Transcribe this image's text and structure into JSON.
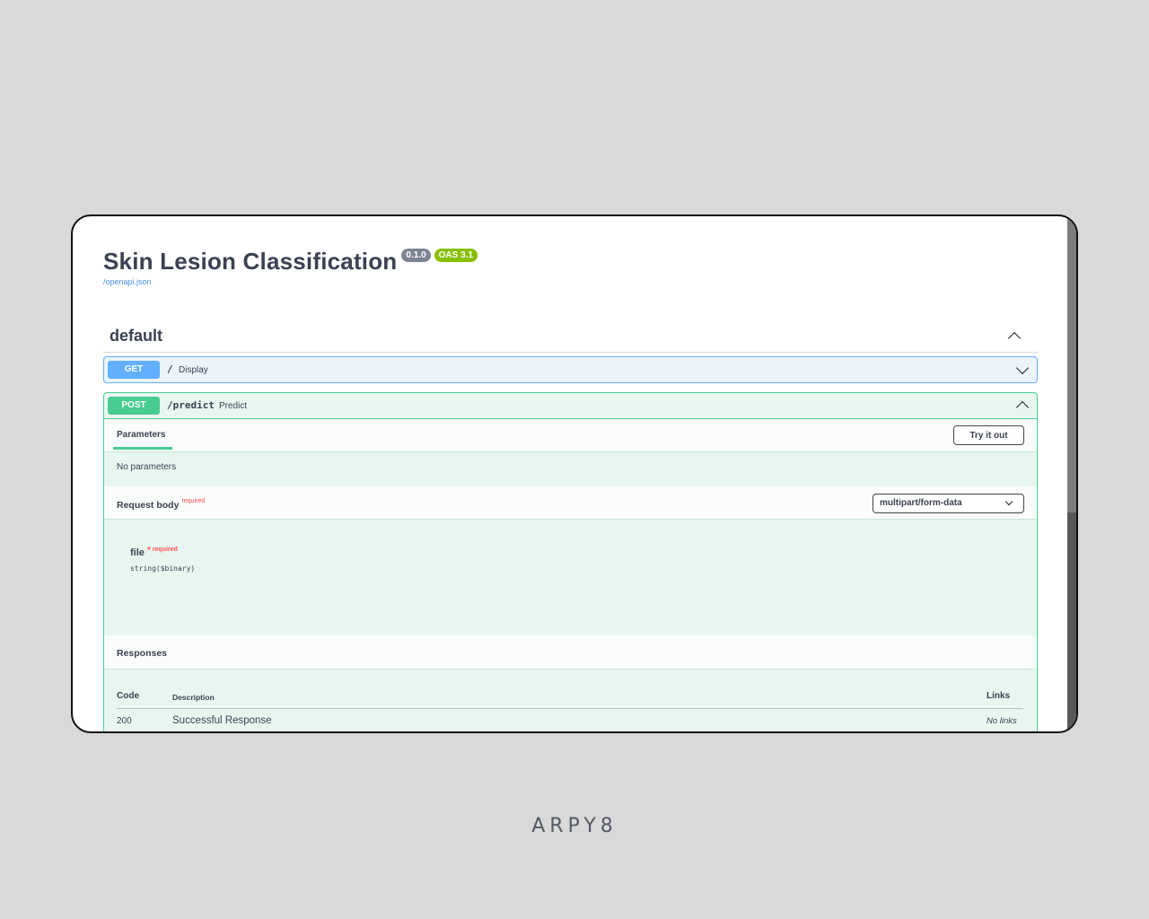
{
  "app": {
    "title": "Skin Lesion Classification",
    "version_badge": "0.1.0",
    "oas_badge": "OAS 3.1",
    "spec_link": "/openapi.json"
  },
  "tag": {
    "name": "default",
    "expanded": true
  },
  "operations": [
    {
      "method": "GET",
      "path": "/",
      "summary": "Display",
      "expanded": false
    },
    {
      "method": "POST",
      "path": "/predict",
      "summary": "Predict",
      "expanded": true,
      "parameters_tab": "Parameters",
      "try_button": "Try it out",
      "no_params_text": "No parameters",
      "request_body": {
        "label": "Request body",
        "required_text": "required",
        "content_type": "multipart/form-data",
        "field_name": "file",
        "field_star": "*",
        "field_required": "required",
        "field_type": "string($binary)"
      },
      "responses": {
        "label": "Responses",
        "headers": {
          "code": "Code",
          "description": "Description",
          "links": "Links"
        },
        "rows": [
          {
            "code": "200",
            "description": "Successful Response",
            "links": "No links"
          }
        ]
      }
    }
  ],
  "colors": {
    "get": "#61affe",
    "post": "#49cc90",
    "post_bg": "#e8f6f0",
    "get_bg": "#ebf3fb",
    "required": "#ff4f4f",
    "link": "#4990e2"
  },
  "footer": {
    "brand": "ARPY8"
  }
}
